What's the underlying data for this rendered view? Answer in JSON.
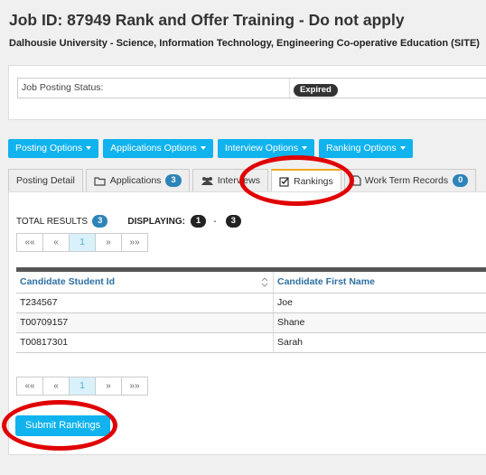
{
  "header": {
    "title": "Job ID: 87949 Rank and Offer Training - Do not apply",
    "subtitle": "Dalhousie University - Science, Information Technology, Engineering Co-operative Education (SITE)"
  },
  "status": {
    "label": "Job Posting Status:",
    "value": "Expired"
  },
  "option_buttons": [
    "Posting Options",
    "Applications Options",
    "Interview Options",
    "Ranking Options"
  ],
  "tabs": [
    {
      "label": "Posting Detail",
      "icon": "none"
    },
    {
      "label": "Applications",
      "icon": "folder-icon",
      "count": "3"
    },
    {
      "label": "Interviews",
      "icon": "users-icon"
    },
    {
      "label": "Rankings",
      "icon": "checkbox-icon",
      "active": true
    },
    {
      "label": "Work Term Records",
      "icon": "document-icon",
      "count": "0"
    }
  ],
  "results": {
    "total_label": "TOTAL RESULTS",
    "total": "3",
    "displaying_label": "DISPLAYING:",
    "from": "1",
    "dash": "-",
    "to": "3"
  },
  "pagination": {
    "first": "««",
    "prev": "«",
    "current": "1",
    "next": "»",
    "last": "»»"
  },
  "table": {
    "columns": [
      "Candidate Student Id",
      "Candidate First Name"
    ],
    "rows": [
      [
        "T234567",
        "Joe"
      ],
      [
        "T00709157",
        "Shane"
      ],
      [
        "T00817301",
        "Sarah"
      ]
    ]
  },
  "submit_label": "Submit Rankings",
  "colors": {
    "accent": "#10b3ee",
    "annotation": "#e00000",
    "active_tab_border": "#f5a623"
  }
}
